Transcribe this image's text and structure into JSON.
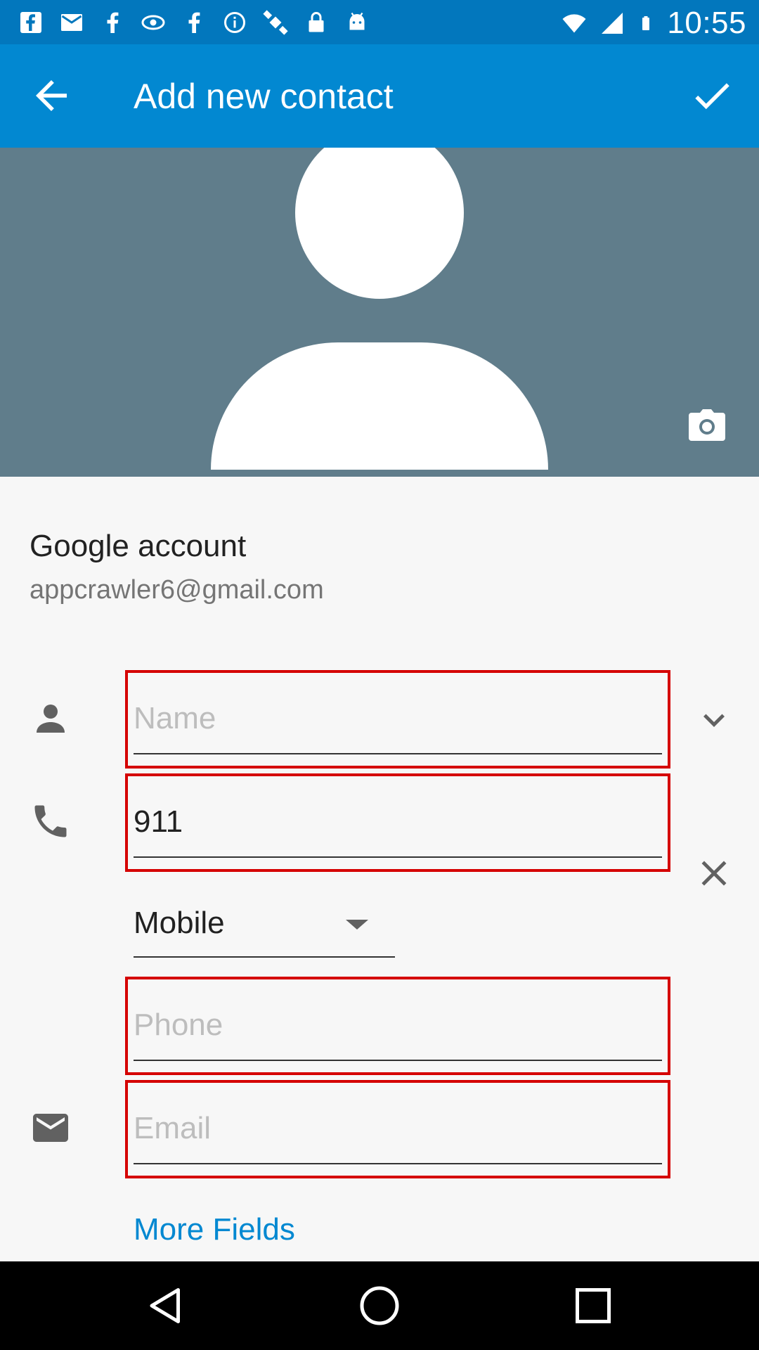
{
  "status_bar": {
    "time": "10:55",
    "icons": [
      "facebook-icon",
      "mail-icon",
      "facebook-icon",
      "eye-icon",
      "facebook-icon",
      "info-icon",
      "satellite-icon",
      "lock-icon",
      "android-icon"
    ]
  },
  "app_bar": {
    "title": "Add new contact",
    "back_icon": "arrow-back-icon",
    "save_icon": "check-icon",
    "background": "#0288d1"
  },
  "photo": {
    "background": "#607d8b",
    "camera_icon": "camera-icon"
  },
  "account": {
    "type": "Google account",
    "email": "appcrawler6@gmail.com"
  },
  "form": {
    "name": {
      "placeholder": "Name",
      "value": ""
    },
    "phone_primary": {
      "value": "911"
    },
    "phone_type": "Mobile",
    "phone_secondary": {
      "placeholder": "Phone",
      "value": ""
    },
    "email": {
      "placeholder": "Email",
      "value": ""
    },
    "more_fields": "More Fields"
  },
  "nav_bar": {
    "buttons": [
      "back-triangle-icon",
      "home-circle-icon",
      "recents-square-icon"
    ]
  }
}
